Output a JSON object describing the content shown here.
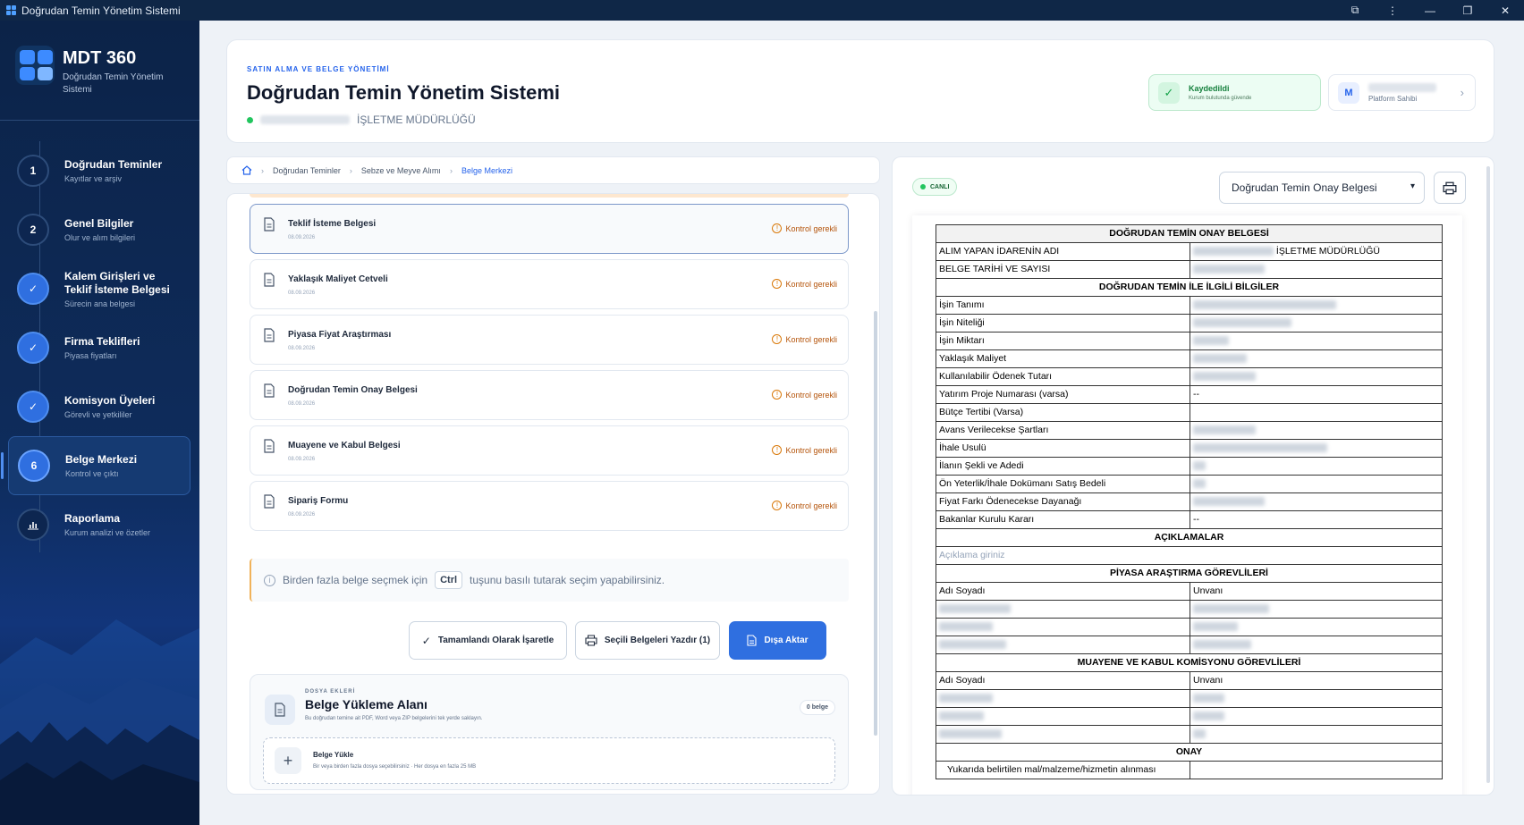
{
  "window": {
    "title": "Doğrudan Temin Yönetim Sistemi"
  },
  "brand": {
    "name": "MDT 360",
    "subtitle": "Doğrudan Temin Yönetim Sistemi"
  },
  "nav": {
    "items": [
      {
        "num": "1",
        "title": "Doğrudan Teminler",
        "sub": "Kayıtlar ve arşiv",
        "state": "todo"
      },
      {
        "num": "2",
        "title": "Genel Bilgiler",
        "sub": "Olur ve alım bilgileri",
        "state": "todo"
      },
      {
        "num": "✓",
        "title": "Kalem Girişleri ve Teklif İsteme Belgesi",
        "sub": "Sürecin ana belgesi",
        "state": "done"
      },
      {
        "num": "✓",
        "title": "Firma Teklifleri",
        "sub": "Piyasa fiyatları",
        "state": "done"
      },
      {
        "num": "✓",
        "title": "Komisyon Üyeleri",
        "sub": "Görevli ve yetkililer",
        "state": "done"
      },
      {
        "num": "6",
        "title": "Belge Merkezi",
        "sub": "Kontrol ve çıktı",
        "state": "active"
      },
      {
        "num": "",
        "title": "Raporlama",
        "sub": "Kurum analizi ve özetler",
        "state": "todo"
      }
    ]
  },
  "header": {
    "eyebrow": "SATIN ALMA VE BELGE YÖNETİMİ",
    "title": "Doğrudan Temin Yönetim Sistemi",
    "org_suffix": "İŞLETME MÜDÜRLÜĞÜ",
    "saved_title": "Kaydedildi",
    "saved_sub": "Kurum bulutunda güvende",
    "user_initial": "M",
    "user_role": "Platform Sahibi"
  },
  "breadcrumb": {
    "items": [
      "Doğrudan Teminler",
      "Sebze ve Meyve Alımı",
      "Belge Merkezi"
    ]
  },
  "documents": [
    {
      "name": "Teklif İsteme Belgesi",
      "date": "08.09.2026",
      "status": "Kontrol gerekli"
    },
    {
      "name": "Yaklaşık Maliyet Cetveli",
      "date": "08.09.2026",
      "status": "Kontrol gerekli"
    },
    {
      "name": "Piyasa Fiyat Araştırması",
      "date": "08.09.2026",
      "status": "Kontrol gerekli"
    },
    {
      "name": "Doğrudan Temin Onay Belgesi",
      "date": "08.09.2026",
      "status": "Kontrol gerekli"
    },
    {
      "name": "Muayene ve Kabul Belgesi",
      "date": "08.09.2026",
      "status": "Kontrol gerekli"
    },
    {
      "name": "Sipariş Formu",
      "date": "08.09.2026",
      "status": "Kontrol gerekli"
    }
  ],
  "hint": {
    "pre": "Birden fazla belge seçmek için",
    "key": "Ctrl",
    "post": "tuşunu basılı tutarak seçim yapabilirsiniz."
  },
  "actions": {
    "complete": "Tamamlandı Olarak İşaretle",
    "print": "Seçili Belgeleri Yazdır (1)",
    "export": "Dışa Aktar"
  },
  "upload": {
    "eyebrow": "DOSYA EKLERİ",
    "title": "Belge Yükleme Alanı",
    "sub": "Bu doğrudan temine ait PDF, Word veya ZIP belgelerini tek yerde saklayın.",
    "badge": "0 belge",
    "drop_title": "Belge Yükle",
    "drop_sub": "Bir veya birden fazla dosya seçebilirsiniz · Her dosya en fazla 25 MB"
  },
  "preview": {
    "live": "CANLI",
    "selected": "Doğrudan Temin Onay Belgesi",
    "doc": {
      "title": "DOĞRUDAN TEMİN ONAY BELGESİ",
      "row1": "ALIM YAPAN İDARENİN ADI",
      "row1_val": "İŞLETME MÜDÜRLÜĞÜ",
      "row2": "BELGE TARİHİ VE SAYISI",
      "section1": "DOĞRUDAN TEMİN İLE İLGİLİ BİLGİLER",
      "fields": [
        "İşin Tanımı",
        "İşin Niteliği",
        "İşin Miktarı",
        "Yaklaşık Maliyet",
        "Kullanılabilir Ödenek Tutarı",
        "Yatırım Proje Numarası (varsa)",
        "Bütçe Tertibi (Varsa)",
        "Avans Verilecekse Şartları",
        "İhale Usulü",
        "İlanın Şekli ve Adedi",
        "Ön Yeterlik/İhale Dokümanı Satış Bedeli",
        "Fiyat Farkı Ödenecekse Dayanağı",
        "Bakanlar Kurulu Kararı"
      ],
      "dash": "--",
      "section2": "AÇIKLAMALAR",
      "desc_placeholder": "Açıklama giriniz",
      "section3": "PİYASA ARAŞTIRMA GÖREVLİLERİ",
      "col_name": "Adı Soyadı",
      "col_title": "Unvanı",
      "section4": "MUAYENE VE KABUL KOMİSYONU GÖREVLİLERİ",
      "section5": "ONAY",
      "approval_text": "Yukarıda belirtilen mal/malzeme/hizmetin alınması"
    }
  },
  "colors": {
    "accent": "#2f6fe0",
    "sidebar": "#0e2c5c",
    "warning": "#b45309",
    "success": "#15803d"
  }
}
